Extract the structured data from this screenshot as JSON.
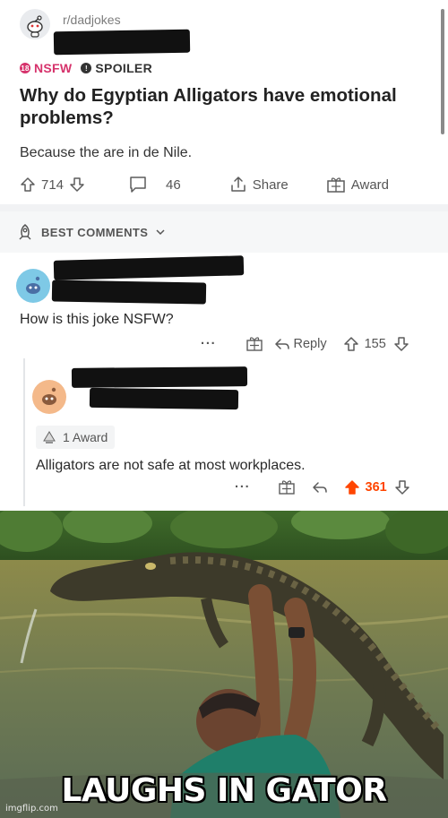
{
  "post": {
    "subreddit": "r/dadjokes",
    "tag_nsfw": "NSFW",
    "tag_spoiler": "SPOILER",
    "title": "Why do Egyptian Alligators have emotional problems?",
    "body": "Because the are in de Nile.",
    "upvotes": "714",
    "comments": "46",
    "share_label": "Share",
    "award_label": "Award"
  },
  "sort": {
    "label": "BEST COMMENTS"
  },
  "comments": [
    {
      "text": "How is this joke NSFW?",
      "more": "···",
      "reply_label": "Reply",
      "votes": "155"
    },
    {
      "award_badge": "1 Award",
      "text": "Alligators are not safe at most workplaces.",
      "more": "···",
      "votes": "361"
    }
  ],
  "meme": {
    "caption": "LAUGHS IN GATOR",
    "watermark": "imgflip.com"
  },
  "colors": {
    "nsfw": "#d6336c",
    "upvote_active": "#ff4500",
    "icon_gray": "#5c5c5c"
  }
}
